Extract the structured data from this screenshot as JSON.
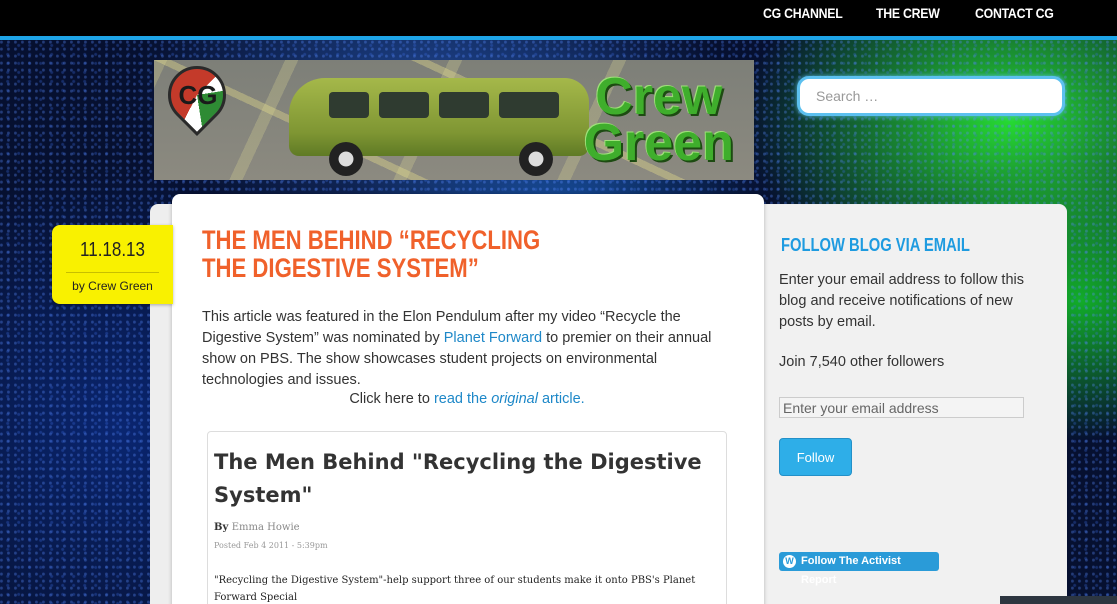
{
  "nav": {
    "items": [
      "CG CHANNEL",
      "THE CREW",
      "CONTACT CG"
    ]
  },
  "header": {
    "logo_letters": "CG",
    "brand_line1": "Crew",
    "brand_line2": "Green"
  },
  "search": {
    "placeholder": "Search …"
  },
  "post": {
    "date": "11.18.13",
    "author_prefix": "by",
    "author": "Crew Green",
    "title": "THE MEN BEHIND “RECYCLING THE DIGESTIVE SYSTEM”",
    "para_part1": "This article was featured in the Elon Pendulum after my video “Recycle the Digestive System” was nominated by ",
    "para_link": "Planet Forward",
    "para_part2": " to premier on their annual show on PBS. The show showcases student projects on environmental technologies and issues.",
    "click_prefix": "Click here to ",
    "click_link_a": "read the ",
    "click_link_em": "original",
    "click_link_b": " article."
  },
  "embed": {
    "title": "The Men Behind \"Recycling the Digestive System\"",
    "by_label": "By",
    "by_author": "Emma Howie",
    "posted": "Posted Feb 4 2011 - 5:39pm",
    "excerpt": "\"Recycling the Digestive System\"-help support three of our students make it onto PBS's Planet Forward Special"
  },
  "sidebar": {
    "widget_title": "FOLLOW BLOG VIA EMAIL",
    "description": "Enter your email address to follow this blog and receive notifications of new posts by email.",
    "followers": "Join 7,540 other followers",
    "email_placeholder": "Enter your email address",
    "follow_label": "Follow",
    "badge_label": "Follow The Activist Report"
  },
  "colors": {
    "accent": "#1ea4e8",
    "title_orange": "#f0612b",
    "date_yellow": "#f9f100",
    "link_blue": "#1e88c8"
  },
  "icons": {
    "wordpress": "wordpress-icon"
  }
}
